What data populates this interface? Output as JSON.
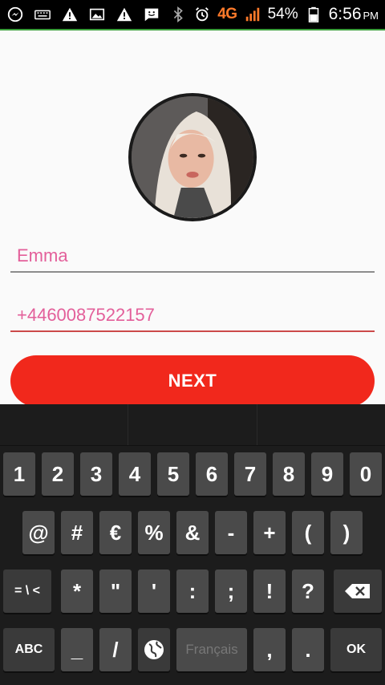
{
  "status_bar": {
    "network": "4G",
    "battery": "54%",
    "time": "6:56",
    "ampm": "PM"
  },
  "form": {
    "name_value": "Emma",
    "phone_value": "+4460087522157",
    "next_label": "NEXT"
  },
  "keyboard": {
    "row1": [
      "1",
      "2",
      "3",
      "4",
      "5",
      "6",
      "7",
      "8",
      "9",
      "0"
    ],
    "row2": [
      "@",
      "#",
      "€",
      "%",
      "&",
      "-",
      "+",
      "(",
      ")"
    ],
    "row3_symbols_toggle": "= \\ <",
    "row3": [
      "*",
      "\"",
      "'",
      ":",
      ";",
      "!",
      "?"
    ],
    "abc_label": "ABC",
    "underscore": "_",
    "slash": "/",
    "space_label": "Français",
    "comma": ",",
    "period": ".",
    "ok_label": "OK"
  }
}
